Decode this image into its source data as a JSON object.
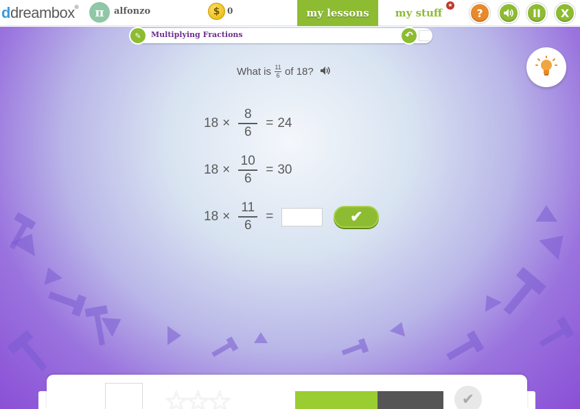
{
  "app": {
    "logo_text": "dreambox",
    "username": "alfonzo",
    "avatar_symbol": "π",
    "coin_symbol": "$",
    "coin_count": "0"
  },
  "nav": {
    "my_lessons": "my lessons",
    "my_stuff": "my stuff",
    "my_stuff_badge": "★",
    "help": "?",
    "sound": "◀)",
    "pause": "II",
    "close": "X"
  },
  "lesson": {
    "title": "Multiplying Fractions",
    "back_symbol": "↶"
  },
  "question": {
    "prefix": "What is",
    "frac_num": "11",
    "frac_den": "6",
    "suffix": "of 18?"
  },
  "equations": [
    {
      "left": "18",
      "op": "×",
      "num": "8",
      "den": "6",
      "eq": "=",
      "result": "24"
    },
    {
      "left": "18",
      "op": "×",
      "num": "10",
      "den": "6",
      "eq": "=",
      "result": "30"
    },
    {
      "left": "18",
      "op": "×",
      "num": "11",
      "den": "6",
      "eq": "=",
      "result": ""
    }
  ],
  "check_symbol": "✔",
  "colors": {
    "accent_green": "#8dbb32",
    "help_orange": "#e8892a",
    "lesson_title_purple": "#6b2d8c"
  }
}
